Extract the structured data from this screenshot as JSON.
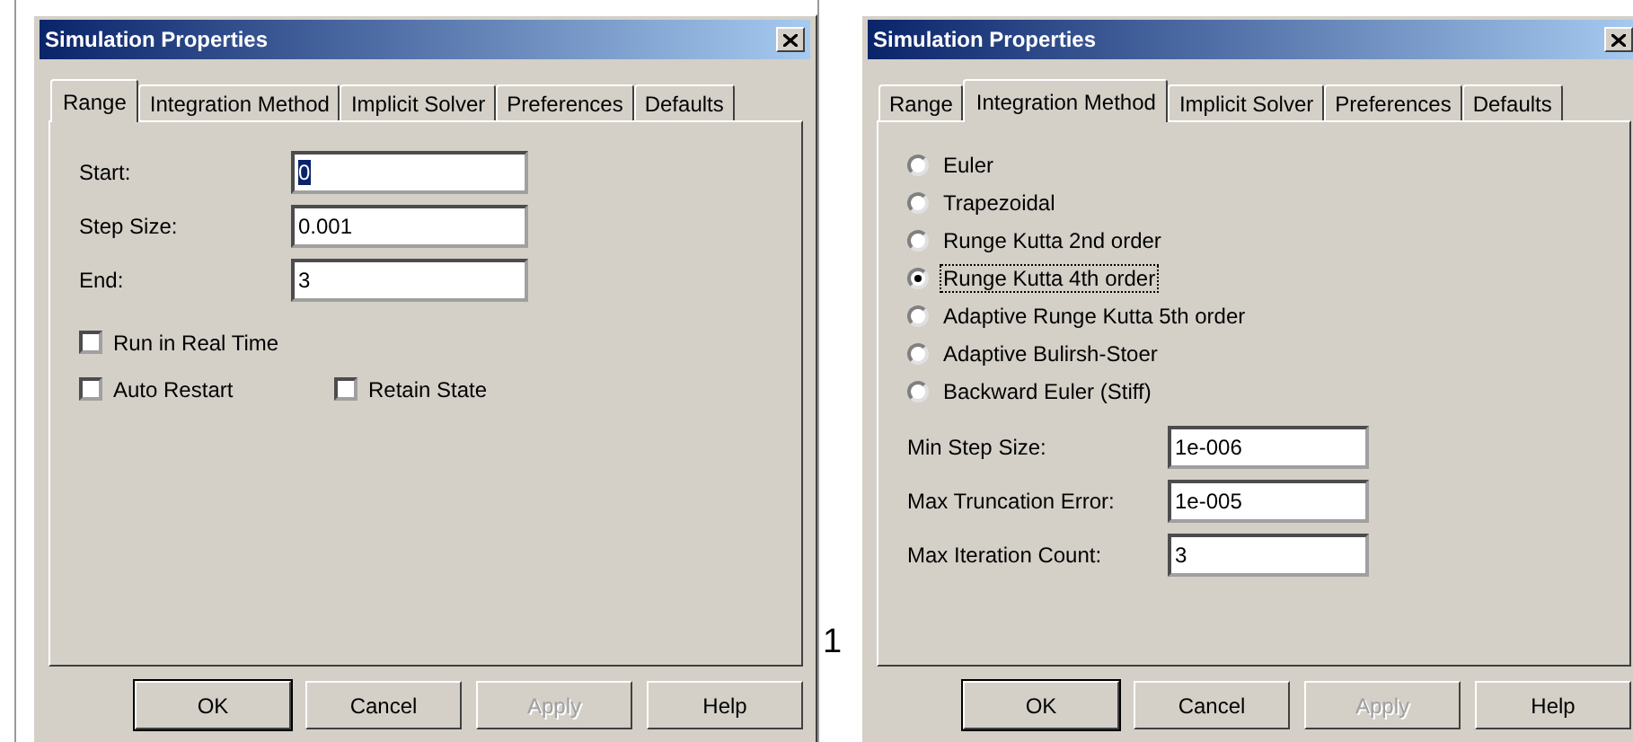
{
  "background_text": "1",
  "dialogs": [
    {
      "title": "Simulation Properties",
      "tabs": [
        {
          "label": "Range",
          "selected": true
        },
        {
          "label": "Integration Method",
          "selected": false
        },
        {
          "label": "Implicit Solver",
          "selected": false
        },
        {
          "label": "Preferences",
          "selected": false
        },
        {
          "label": "Defaults",
          "selected": false
        }
      ],
      "page": {
        "kind": "range",
        "fields": [
          {
            "label": "Start:",
            "value": "0",
            "focused": true
          },
          {
            "label": "Step Size:",
            "value": "0.001",
            "focused": false
          },
          {
            "label": "End:",
            "value": "3",
            "focused": false
          }
        ],
        "checkbox_rows": [
          [
            {
              "label": "Run in Real Time",
              "checked": false
            }
          ],
          [
            {
              "label": "Auto Restart",
              "checked": false
            },
            {
              "label": "Retain State",
              "checked": false
            }
          ]
        ]
      },
      "buttons": [
        {
          "label": "OK",
          "default": true,
          "disabled": false
        },
        {
          "label": "Cancel",
          "default": false,
          "disabled": false
        },
        {
          "label": "Apply",
          "default": false,
          "disabled": true
        },
        {
          "label": "Help",
          "default": false,
          "disabled": false
        }
      ]
    },
    {
      "title": "Simulation Properties",
      "tabs": [
        {
          "label": "Range",
          "selected": false
        },
        {
          "label": "Integration Method",
          "selected": true
        },
        {
          "label": "Implicit Solver",
          "selected": false
        },
        {
          "label": "Preferences",
          "selected": false
        },
        {
          "label": "Defaults",
          "selected": false
        }
      ],
      "page": {
        "kind": "integration",
        "methods": [
          {
            "label": "Euler",
            "selected": false
          },
          {
            "label": "Trapezoidal",
            "selected": false
          },
          {
            "label": "Runge Kutta 2nd order",
            "selected": false
          },
          {
            "label": "Runge Kutta 4th order",
            "selected": true
          },
          {
            "label": "Adaptive Runge Kutta 5th order",
            "selected": false
          },
          {
            "label": "Adaptive Bulirsh-Stoer",
            "selected": false
          },
          {
            "label": "Backward Euler (Stiff)",
            "selected": false
          }
        ],
        "fields": [
          {
            "label": "Min Step Size:",
            "value": "1e-006",
            "focused": false
          },
          {
            "label": "Max Truncation Error:",
            "value": "1e-005",
            "focused": false
          },
          {
            "label": "Max Iteration Count:",
            "value": "3",
            "focused": false
          }
        ]
      },
      "buttons": [
        {
          "label": "OK",
          "default": true,
          "disabled": false
        },
        {
          "label": "Cancel",
          "default": false,
          "disabled": false
        },
        {
          "label": "Apply",
          "default": false,
          "disabled": true
        },
        {
          "label": "Help",
          "default": false,
          "disabled": false
        }
      ]
    }
  ]
}
